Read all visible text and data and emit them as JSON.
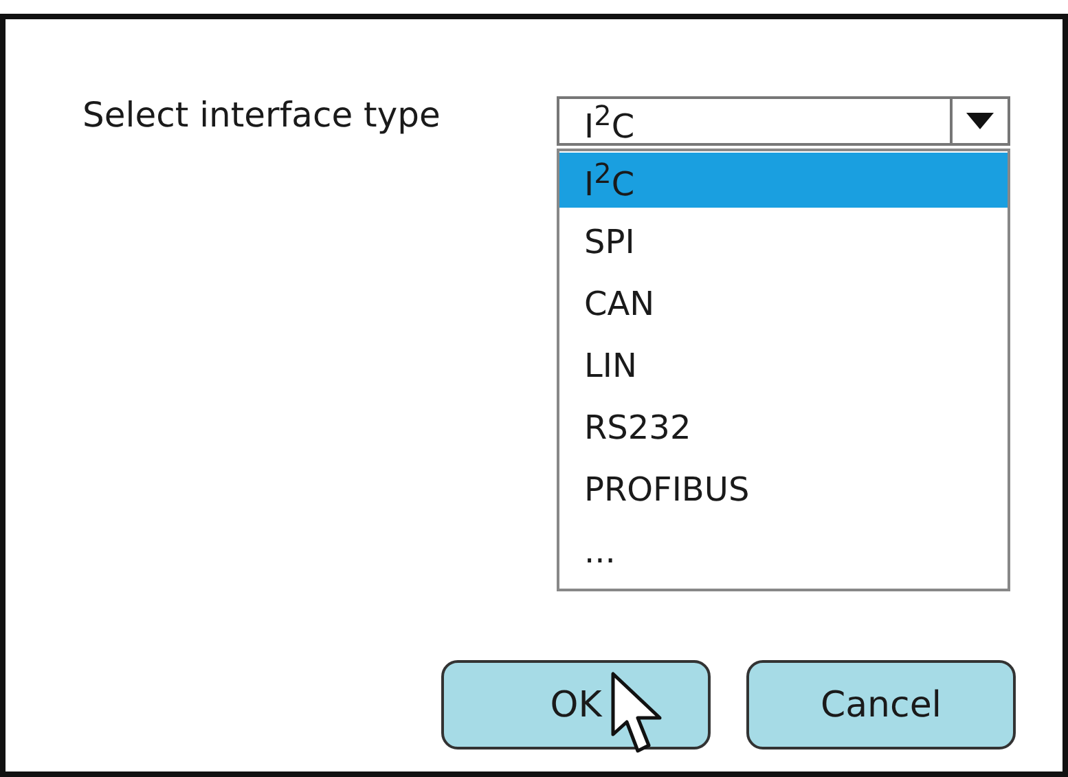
{
  "dialog": {
    "label": "Select interface type",
    "combo": {
      "value": "I$^{2}$C",
      "expanded": true
    },
    "options": [
      {
        "label": "I$^{2}$C",
        "selected": true
      },
      {
        "label": "SPI",
        "selected": false
      },
      {
        "label": "CAN",
        "selected": false
      },
      {
        "label": "LIN",
        "selected": false
      },
      {
        "label": "RS232",
        "selected": false
      },
      {
        "label": "PROFIBUS",
        "selected": false
      },
      {
        "label": "...",
        "selected": false
      }
    ],
    "buttons": [
      {
        "label": "OK",
        "hovered": true
      },
      {
        "label": "Cancel",
        "hovered": false
      }
    ]
  }
}
